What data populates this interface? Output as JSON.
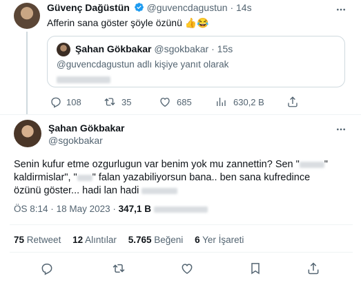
{
  "reply_tweet": {
    "name": "Güvenç Dağüstün",
    "handle": "@guvencdagustun",
    "dot": "·",
    "time": "14s",
    "text": "Afferin sana göster şöyle özünü 👍😂",
    "quote": {
      "name": "Şahan Gökbakar",
      "handle": "@sgokbakar",
      "dot": "·",
      "time": "15s",
      "reply_to": "@guvencdagustun adlı kişiye yanıt olarak"
    },
    "actions": {
      "replies": "108",
      "retweets": "35",
      "likes": "685",
      "views": "630,2 B"
    }
  },
  "main_tweet": {
    "name": "Şahan Gökbakar",
    "handle": "@sgokbakar",
    "text_part1": "Senin kufur etme ozgurlugun var benim yok mu zannettin? Sen \"",
    "text_part2": "kaldirmislar\", \"",
    "text_part3": "\" falan yazabiliyorsun bana.. ben sana kufredince",
    "text_part4": "özünü göster... hadi lan hadi",
    "meta": {
      "time": "ÖS 8:14",
      "dot1": "·",
      "date": "18 May 2023",
      "dot2": "·",
      "views_count": "347,1 B"
    },
    "stats": [
      {
        "count": "75",
        "label": "Retweet"
      },
      {
        "count": "12",
        "label": "Alıntılar"
      },
      {
        "count": "5.765",
        "label": "Beğeni"
      },
      {
        "count": "6",
        "label": "Yer İşareti"
      }
    ]
  },
  "colors": {
    "verified": "#1d9bf0",
    "text": "#0f1419",
    "muted": "#536471",
    "divider": "#eff3f4"
  },
  "icons": [
    "more-icon",
    "verified-badge-icon",
    "reply-icon",
    "retweet-icon",
    "like-icon",
    "views-icon",
    "share-icon"
  ]
}
